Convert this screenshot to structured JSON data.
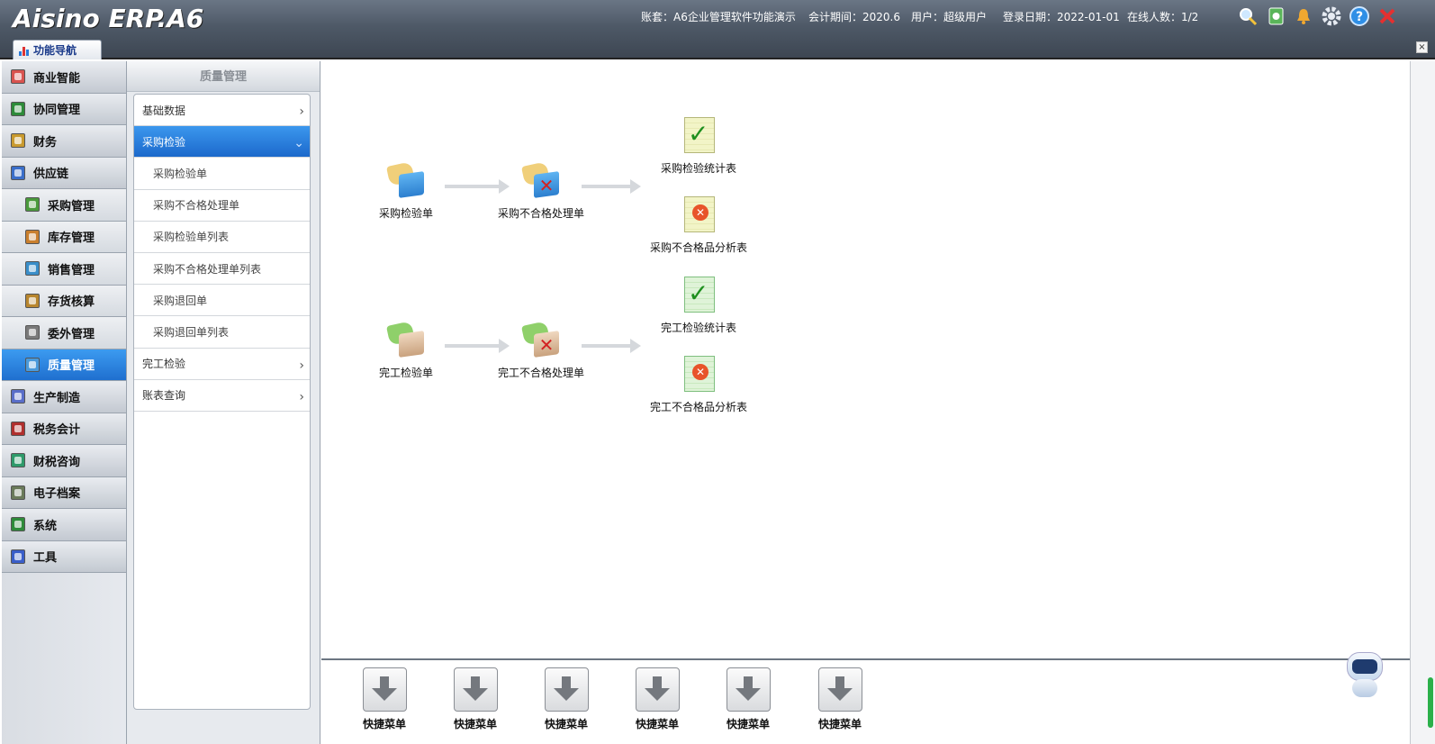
{
  "header": {
    "logo": "Aisino ERP.A6",
    "account_set": "账套：A6企业管理软件功能演示",
    "period": "会计期间：2020.6",
    "user": "用户：超级用户",
    "login_date": "登录日期：2022-01-01",
    "online": "在线人数：1/2",
    "icons": [
      "search-icon",
      "notebook-icon",
      "bell-icon",
      "gear-icon",
      "help-icon",
      "close-icon"
    ],
    "tab_label": "功能导航"
  },
  "sidebar": {
    "items": [
      {
        "label": "商业智能",
        "level": 0,
        "color": "#d9534f"
      },
      {
        "label": "协同管理",
        "level": 0,
        "color": "#2e8b3a"
      },
      {
        "label": "财务",
        "level": 0,
        "color": "#c99a2e"
      },
      {
        "label": "供应链",
        "level": 0,
        "color": "#3a6ec9"
      },
      {
        "label": "采购管理",
        "level": 1,
        "color": "#4a9a3c"
      },
      {
        "label": "库存管理",
        "level": 1,
        "color": "#c97f2e"
      },
      {
        "label": "销售管理",
        "level": 1,
        "color": "#3a8ec9"
      },
      {
        "label": "存货核算",
        "level": 1,
        "color": "#b8862e"
      },
      {
        "label": "委外管理",
        "level": 1,
        "color": "#7a7a7a"
      },
      {
        "label": "质量管理",
        "level": 1,
        "color": "#4a9adb",
        "active": true
      },
      {
        "label": "生产制造",
        "level": 0,
        "color": "#5a6ec9"
      },
      {
        "label": "税务会计",
        "level": 0,
        "color": "#b0302e"
      },
      {
        "label": "财税咨询",
        "level": 0,
        "color": "#2e9a6a"
      },
      {
        "label": "电子档案",
        "level": 0,
        "color": "#6a7a5a"
      },
      {
        "label": "系统",
        "level": 0,
        "color": "#2e8b3a"
      },
      {
        "label": "工具",
        "level": 0,
        "color": "#3a5ec9"
      }
    ]
  },
  "panel": {
    "title": "质量管理",
    "items": [
      {
        "label": "基础数据",
        "type": "group",
        "chevron": "›"
      },
      {
        "label": "采购检验",
        "type": "group",
        "selected": true,
        "chevron": "⌄"
      },
      {
        "label": "采购检验单",
        "type": "child"
      },
      {
        "label": "采购不合格处理单",
        "type": "child"
      },
      {
        "label": "采购检验单列表",
        "type": "child"
      },
      {
        "label": "采购不合格处理单列表",
        "type": "child"
      },
      {
        "label": "采购退回单",
        "type": "child"
      },
      {
        "label": "采购退回单列表",
        "type": "child"
      },
      {
        "label": "完工检验",
        "type": "group",
        "chevron": "›"
      },
      {
        "label": "账表查询",
        "type": "group",
        "chevron": "›"
      }
    ]
  },
  "flow": {
    "purchase": {
      "inspection": "采购检验单",
      "nonconform": "采购不合格处理单",
      "stats": "采购检验统计表",
      "analysis": "采购不合格品分析表"
    },
    "finished": {
      "inspection": "完工检验单",
      "nonconform": "完工不合格处理单",
      "stats": "完工检验统计表",
      "analysis": "完工不合格品分析表"
    }
  },
  "quick_menu": {
    "items": [
      "快捷菜单",
      "快捷菜单",
      "快捷菜单",
      "快捷菜单",
      "快捷菜单",
      "快捷菜单"
    ]
  }
}
